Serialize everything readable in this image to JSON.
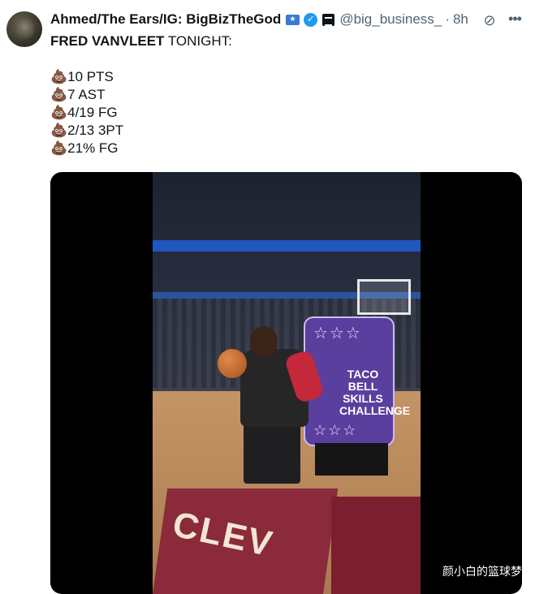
{
  "tweet": {
    "author_name": "Ahmed/The Ears/IG: BigBizTheGod",
    "handle": "@big_business_",
    "separator": "·",
    "time": "8h",
    "lines": [
      {
        "prefix": "",
        "bold": "FRED VANVLEET",
        "text": " TONIGHT:"
      },
      {
        "prefix": "",
        "bold": "",
        "text": ""
      },
      {
        "prefix": "💩",
        "bold": "",
        "text": "10 PTS"
      },
      {
        "prefix": "💩",
        "bold": "",
        "text": "7 AST"
      },
      {
        "prefix": "💩",
        "bold": "",
        "text": "4/19 FG"
      },
      {
        "prefix": "💩",
        "bold": "",
        "text": "2/13 3PT"
      },
      {
        "prefix": "💩",
        "bold": "",
        "text": "21% FG"
      }
    ]
  },
  "icons": {
    "grok": "grok-icon",
    "more": "more-icon"
  },
  "media": {
    "sign_text": "TACO BELL SKILLS CHALLENGE",
    "court_text": "CLEV"
  },
  "watermark": "颜小白的篮球梦",
  "colors": {
    "verified": "#1d9bf0",
    "muted": "#536471",
    "text": "#0f1419"
  }
}
